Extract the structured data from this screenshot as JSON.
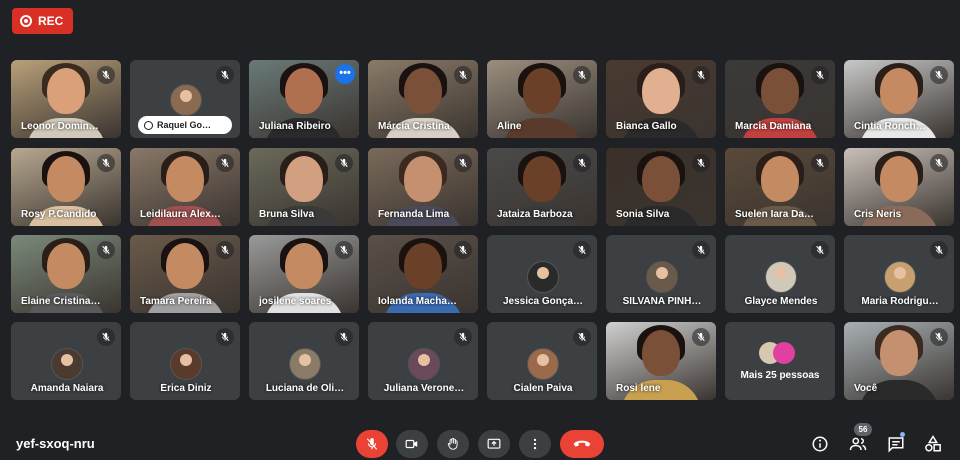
{
  "recording": {
    "label": "REC"
  },
  "meeting": {
    "code": "yef-sxoq-nru",
    "participant_count": "56"
  },
  "colors": {
    "background": "#202124",
    "tile": "#3c4043",
    "red": "#ea4335",
    "accent_blue": "#1a73e8"
  },
  "participants": [
    {
      "name": "Leonor Domin…",
      "type": "video",
      "bg": "#b8a07a",
      "skin": "#d9a07a",
      "hair": "#3a2a20",
      "shirt": "#d0c8b8"
    },
    {
      "name": "Raquel Go…",
      "type": "pinned-avatar"
    },
    {
      "name": "Juliana Ribeiro",
      "type": "video",
      "active": true,
      "bg": "#6a7a78",
      "skin": "#b07050",
      "hair": "#1a1210",
      "shirt": "#2a2a2a"
    },
    {
      "name": "Márcia Cristina",
      "type": "video",
      "bg": "#8a7a68",
      "skin": "#7a5038",
      "hair": "#1a1210",
      "shirt": "#d8d0c4"
    },
    {
      "name": "Aline",
      "type": "video",
      "bg": "#9a8e7e",
      "skin": "#6a4028",
      "hair": "#1a120e",
      "shirt": "#5a3a2a"
    },
    {
      "name": "Bianca Gallo",
      "type": "video",
      "bg": "#4a3a30",
      "skin": "#e0b090",
      "hair": "#2a1e18",
      "shirt": "#2a2a2a"
    },
    {
      "name": "Marcia Damiana",
      "type": "video",
      "bg": "#3a3a3a",
      "skin": "#7a5038",
      "hair": "#1a120e",
      "shirt": "#c04040"
    },
    {
      "name": "Cintia Ronch…",
      "type": "video",
      "bg": "#c8c8c8",
      "skin": "#c48b63",
      "hair": "#2a1e18",
      "shirt": "#e8e8e8"
    },
    {
      "name": "Rosy P.Candido",
      "type": "video",
      "bg": "#b8a890",
      "skin": "#c48b63",
      "hair": "#1a1210",
      "shirt": "#d8c0a0"
    },
    {
      "name": "Leidilaura Alex…",
      "type": "video",
      "bg": "#8a7868",
      "skin": "#c48b63",
      "hair": "#2a1e18",
      "shirt": "#a05050"
    },
    {
      "name": "Bruna Silva",
      "type": "video",
      "bg": "#6a6a5a",
      "skin": "#d0a080",
      "hair": "#2a1e18",
      "shirt": "#3a3a3a"
    },
    {
      "name": "Fernanda Lima",
      "type": "video",
      "bg": "#7a6a5a",
      "skin": "#c49070",
      "hair": "#3a2a20",
      "shirt": "#4a4a5a"
    },
    {
      "name": "Jataiza Barboza",
      "type": "video",
      "bg": "#4a4a4a",
      "skin": "#6a4028",
      "hair": "#1a120e",
      "shirt": "#3a3a3a"
    },
    {
      "name": "Sonia Silva",
      "type": "video",
      "bg": "#3a3028",
      "skin": "#7a5038",
      "hair": "#1a120e",
      "shirt": "#2a2a2a"
    },
    {
      "name": "Suelen Iara Da…",
      "type": "video",
      "bg": "#5a4a3a",
      "skin": "#c48b63",
      "hair": "#2a1e18",
      "shirt": "#6a5a4a"
    },
    {
      "name": "Cris Neris",
      "type": "video",
      "bg": "#c8c0b8",
      "skin": "#c48b63",
      "hair": "#2a1e18",
      "shirt": "#8a6a5a"
    },
    {
      "name": "Elaine Cristina…",
      "type": "video",
      "bg": "#7a8a7a",
      "skin": "#c48b63",
      "hair": "#2a1e18",
      "shirt": "#5a5a5a"
    },
    {
      "name": "Tamara Pereira",
      "type": "video",
      "bg": "#6a5a4a",
      "skin": "#c48b63",
      "hair": "#1a1210",
      "shirt": "#a0a0a0"
    },
    {
      "name": "josilene soares",
      "type": "video",
      "bg": "#9a9a9a",
      "skin": "#c48b63",
      "hair": "#1a1210",
      "shirt": "#e0e0e0"
    },
    {
      "name": "Iolanda Macha…",
      "type": "video",
      "bg": "#5a5048",
      "skin": "#6a4028",
      "hair": "#1a120e",
      "shirt": "#3a6ab0"
    },
    {
      "name": "Jessica Gonça…",
      "type": "avatar",
      "av": "#2a2a2a"
    },
    {
      "name": "SILVANA PINH…",
      "type": "avatar",
      "av": "#6a5a4a"
    },
    {
      "name": "Glayce Mendes",
      "type": "avatar",
      "av": "#d0c8b8"
    },
    {
      "name": "Maria Rodrigu…",
      "type": "avatar",
      "av": "#c8a070"
    },
    {
      "name": "Amanda Naiara",
      "type": "avatar",
      "av": "#4a3a30"
    },
    {
      "name": "Érica Diniz",
      "type": "avatar",
      "av": "#5a3a2a"
    },
    {
      "name": "Luciana de Oli…",
      "type": "avatar",
      "av": "#8a7a68"
    },
    {
      "name": "Juliana Verone…",
      "type": "avatar",
      "av": "#6a4a5a"
    },
    {
      "name": "Cialen Paiva",
      "type": "avatar",
      "av": "#9a6a4a"
    },
    {
      "name": "Rosi lene",
      "type": "video",
      "bg": "#d0d0d0",
      "skin": "#7a5038",
      "hair": "#1a120e",
      "shirt": "#c8a050"
    },
    {
      "name": "Mais 25 pessoas",
      "type": "more"
    },
    {
      "name": "Você",
      "type": "video",
      "self": true,
      "bg": "#a8b0b4",
      "skin": "#c49070",
      "hair": "#3a2a20",
      "shirt": "#2a2a2a"
    }
  ],
  "controls": [
    {
      "name": "mic-toggle",
      "icon": "mic-off-icon"
    },
    {
      "name": "camera-toggle",
      "icon": "camera-icon"
    },
    {
      "name": "raise-hand",
      "icon": "hand-icon"
    },
    {
      "name": "present-screen",
      "icon": "present-icon"
    },
    {
      "name": "more-options",
      "icon": "more-vert-icon"
    },
    {
      "name": "leave-call",
      "icon": "hangup-icon"
    }
  ],
  "right_controls": [
    {
      "name": "meeting-details",
      "icon": "info-icon"
    },
    {
      "name": "people",
      "icon": "people-icon"
    },
    {
      "name": "chat",
      "icon": "chat-icon"
    },
    {
      "name": "activities",
      "icon": "activities-icon"
    }
  ]
}
